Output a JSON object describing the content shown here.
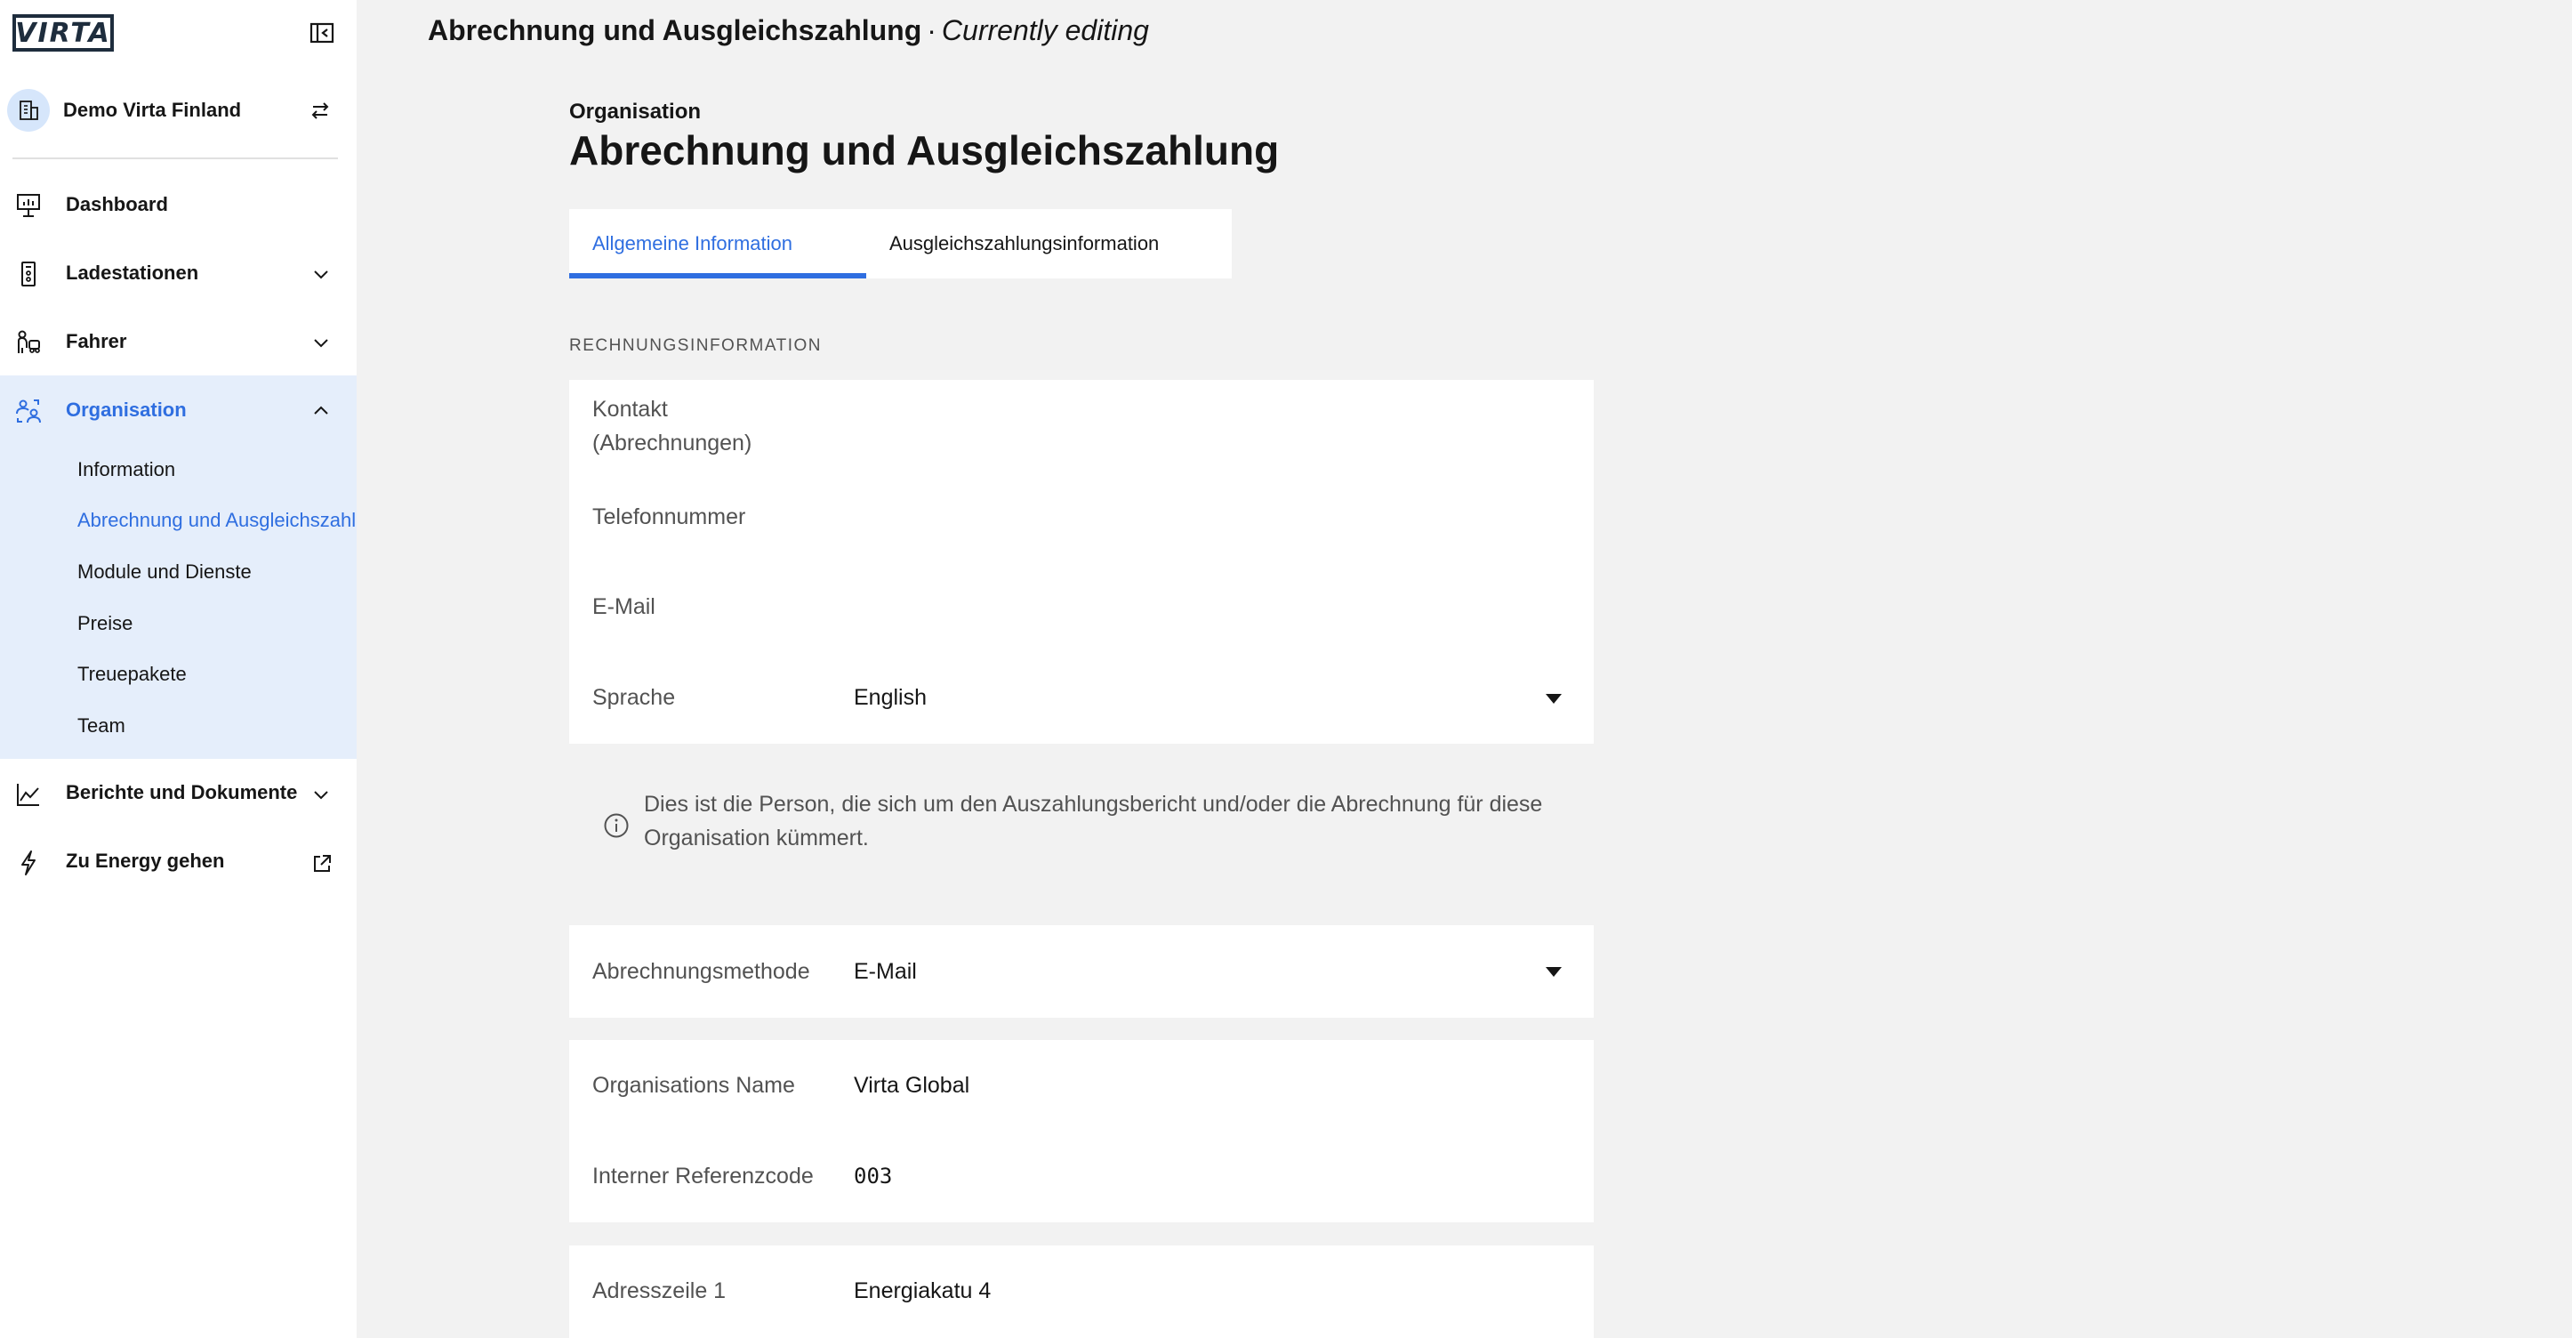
{
  "brand": {
    "logo_text": "VIRTA"
  },
  "org_switcher": {
    "name": "Demo Virta Finland"
  },
  "sidebar": {
    "items": [
      {
        "label": "Dashboard",
        "icon": "dashboard-icon"
      },
      {
        "label": "Ladestationen",
        "icon": "charging-station-icon"
      },
      {
        "label": "Fahrer",
        "icon": "driver-icon"
      },
      {
        "label": "Organisation",
        "icon": "organization-icon"
      },
      {
        "label": "Berichte und Dokumente",
        "icon": "chart-icon"
      },
      {
        "label": "Zu Energy gehen",
        "icon": "lightning-icon"
      }
    ],
    "subitems": [
      {
        "label": "Information"
      },
      {
        "label": "Abrechnung und Ausgleichszahlung"
      },
      {
        "label": "Module und Dienste"
      },
      {
        "label": "Preise"
      },
      {
        "label": "Treuepakete"
      },
      {
        "label": "Team"
      }
    ]
  },
  "header": {
    "title": "Abrechnung und Ausgleichszahlung",
    "separator": "·",
    "status": "Currently editing"
  },
  "page": {
    "breadcrumb": "Organisation",
    "title": "Abrechnung und Ausgleichszahlung",
    "tabs": [
      {
        "label": "Allgemeine Information",
        "active": true
      },
      {
        "label": "Ausgleichszahlungsinformation",
        "active": false
      }
    ],
    "section_label": "RECHNUNGSINFORMATION"
  },
  "form": {
    "contact_label": "Kontakt (Abrechnungen)",
    "phone_label": "Telefonnummer",
    "email_label": "E-Mail",
    "language_label": "Sprache",
    "language_value": "English",
    "info_text": "Dies ist die Person, die sich um den Auszahlungsbericht und/oder die Abrechnung für diese Organisation kümmert.",
    "billing_method_label": "Abrechnungsmethode",
    "billing_method_value": "E-Mail",
    "org_name_label": "Organisations Name",
    "org_name_value": "Virta Global",
    "ref_code_label": "Interner Referenzcode",
    "ref_code_value": "003",
    "address1_label": "Adresszeile 1",
    "address1_value": "Energiakatu 4"
  },
  "colors": {
    "accent": "#2f6ee0",
    "active_bg": "#e5eefb",
    "page_bg": "#f2f2f2",
    "text": "#161616",
    "muted_text": "#525252"
  }
}
